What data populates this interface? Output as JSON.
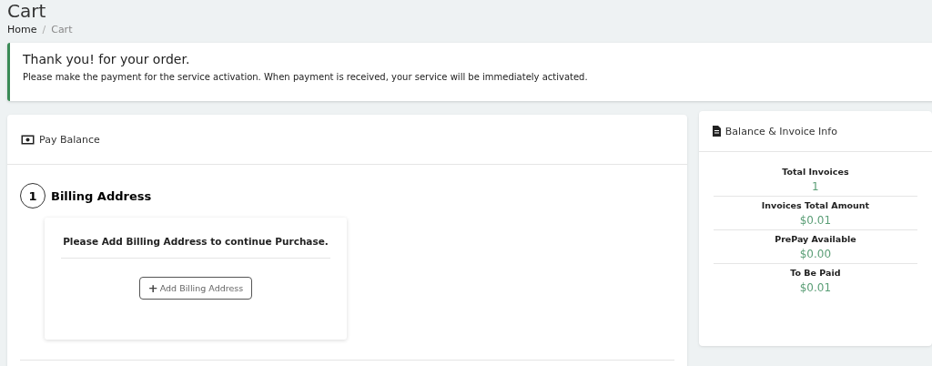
{
  "page_title": "Cart",
  "breadcrumb_separator": "/",
  "breadcrumb": [
    {
      "label": "Home",
      "current": false
    },
    {
      "label": "Cart",
      "current": true
    }
  ],
  "alert": {
    "title": "Thank you! for your order.",
    "message": "Please make the payment for the service activation. When payment is received, your service will be immediately activated."
  },
  "pay_card": {
    "title": "Pay Balance",
    "step": {
      "number": "1",
      "title": "Billing Address"
    },
    "notice": "Please Add Billing Address to continue Purchase.",
    "button": {
      "icon": "+",
      "label": "Add Billing Address"
    }
  },
  "info_card": {
    "title": "Balance & Invoice Info",
    "items": [
      {
        "label": "Total Invoices",
        "value": "1"
      },
      {
        "label": "Invoices Total Amount",
        "value": "$0.01"
      },
      {
        "label": "PrePay Available",
        "value": "$0.00"
      },
      {
        "label": "To Be Paid",
        "value": "$0.01"
      }
    ]
  }
}
